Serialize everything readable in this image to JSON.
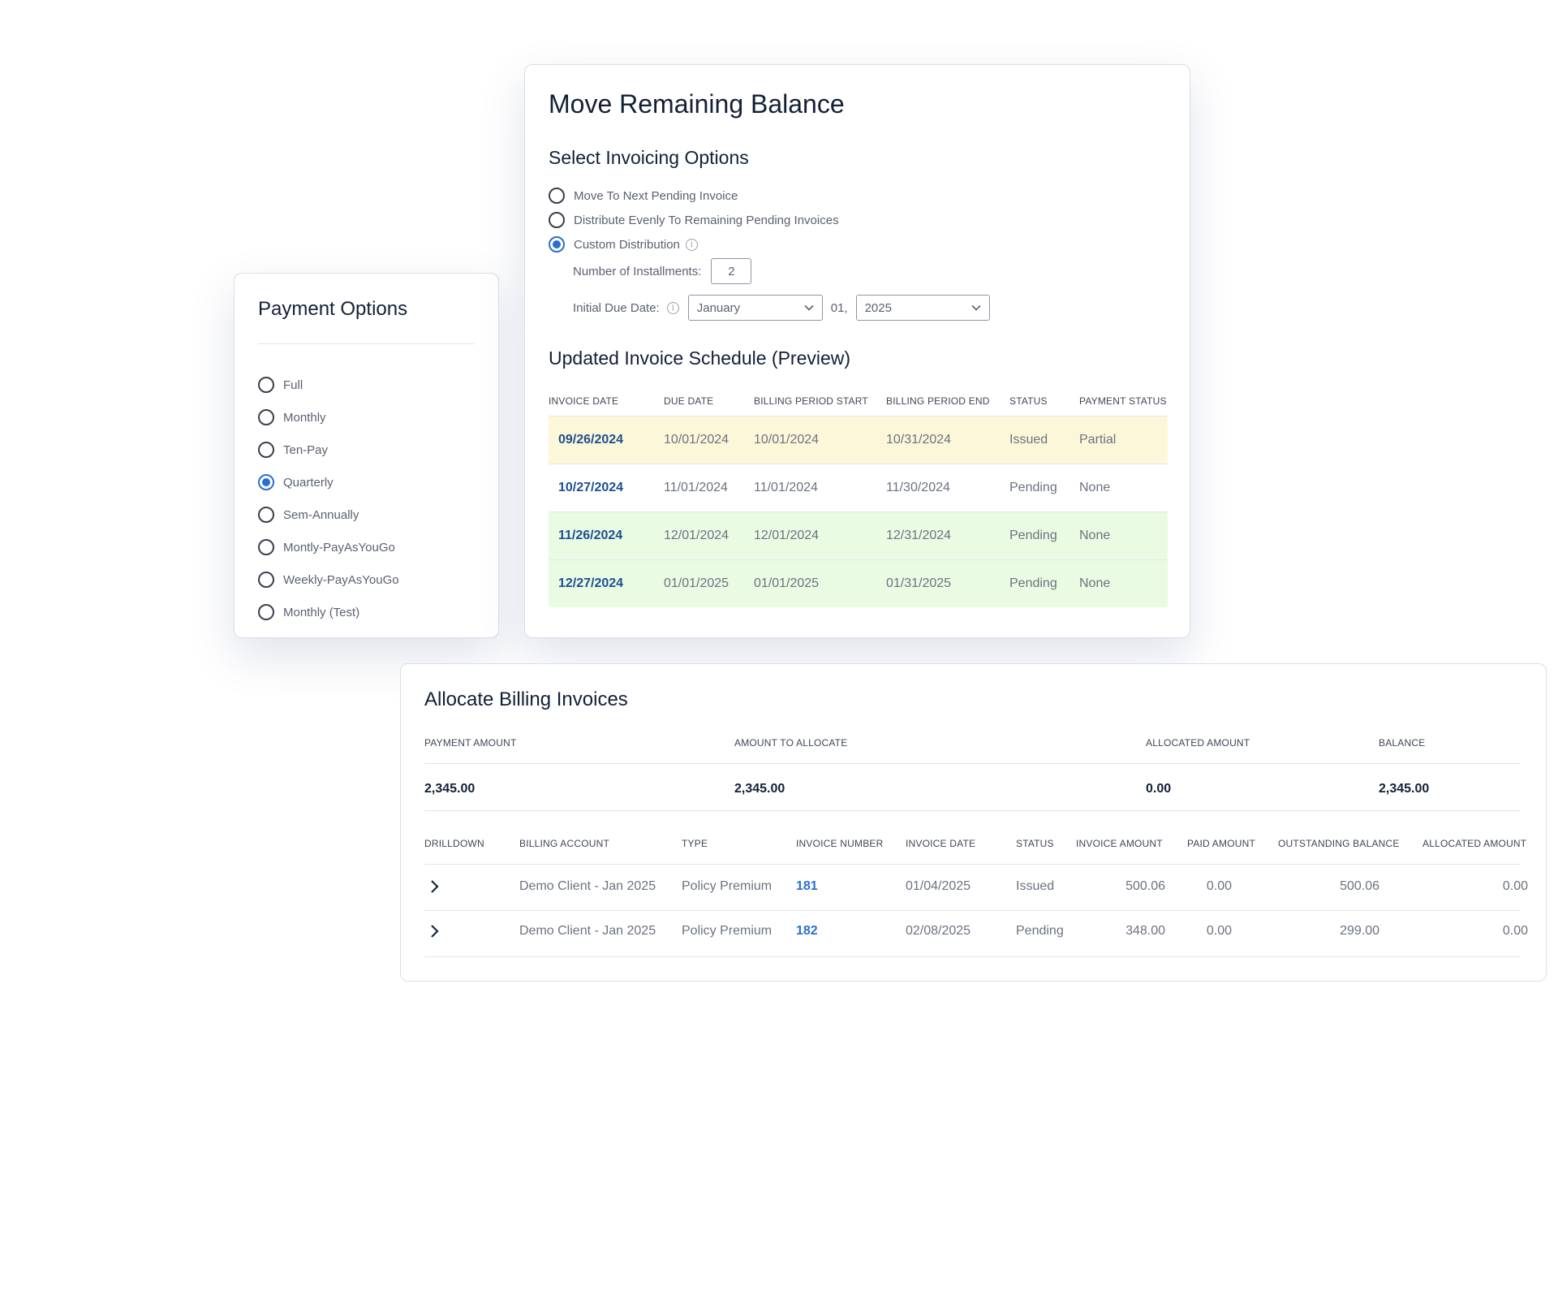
{
  "payment_options": {
    "title": "Payment Options",
    "options": [
      {
        "label": "Full",
        "selected": false
      },
      {
        "label": "Monthly",
        "selected": false
      },
      {
        "label": "Ten-Pay",
        "selected": false
      },
      {
        "label": "Quarterly",
        "selected": true
      },
      {
        "label": "Sem-Annually",
        "selected": false
      },
      {
        "label": "Montly-PayAsYouGo",
        "selected": false
      },
      {
        "label": "Weekly-PayAsYouGo",
        "selected": false
      },
      {
        "label": "Monthly (Test)",
        "selected": false
      }
    ]
  },
  "move_balance": {
    "title": "Move Remaining Balance",
    "subtitle": "Select Invoicing Options",
    "options": [
      {
        "label": "Move To Next Pending Invoice",
        "selected": false
      },
      {
        "label": "Distribute Evenly To Remaining Pending Invoices",
        "selected": false
      },
      {
        "label": "Custom Distribution",
        "selected": true
      }
    ],
    "installments_label": "Number of Installments:",
    "installments_value": "2",
    "due_date_label": "Initial Due Date:",
    "due_month": "January",
    "due_day": "01,",
    "due_year": "2025",
    "schedule_title": "Updated Invoice Schedule (Preview)",
    "schedule_headers": [
      "INVOICE DATE",
      "DUE DATE",
      "BILLING PERIOD START",
      "BILLING PERIOD END",
      "STATUS",
      "PAYMENT STATUS"
    ],
    "schedule_rows": [
      {
        "invoice_date": "09/26/2024",
        "due_date": "10/01/2024",
        "period_start": "10/01/2024",
        "period_end": "10/31/2024",
        "status": "Issued",
        "payment_status": "Partial",
        "highlight": "#fcf7d9"
      },
      {
        "invoice_date": "10/27/2024",
        "due_date": "11/01/2024",
        "period_start": "11/01/2024",
        "period_end": "11/30/2024",
        "status": "Pending",
        "payment_status": "None",
        "highlight": "#ffffff"
      },
      {
        "invoice_date": "11/26/2024",
        "due_date": "12/01/2024",
        "period_start": "12/01/2024",
        "period_end": "12/31/2024",
        "status": "Pending",
        "payment_status": "None",
        "highlight": "#eafbe4"
      },
      {
        "invoice_date": "12/27/2024",
        "due_date": "01/01/2025",
        "period_start": "01/01/2025",
        "period_end": "01/31/2025",
        "status": "Pending",
        "payment_status": "None",
        "highlight": "#eafbe4"
      }
    ]
  },
  "allocate": {
    "title": "Allocate Billing Invoices",
    "summary_headers": {
      "payment_amount": "PAYMENT AMOUNT",
      "amount_to_allocate": "AMOUNT TO ALLOCATE",
      "allocated_amount": "ALLOCATED AMOUNT",
      "balance": "BALANCE"
    },
    "summary_values": {
      "payment_amount": "2,345.00",
      "amount_to_allocate": "2,345.00",
      "allocated_amount": "0.00",
      "balance": "2,345.00"
    },
    "table_headers": {
      "drilldown": "DRILLDOWN",
      "billing_account": "BILLING ACCOUNT",
      "type": "TYPE",
      "invoice_number": "INVOICE NUMBER",
      "invoice_date": "INVOICE DATE",
      "status": "STATUS",
      "invoice_amount": "INVOICE AMOUNT",
      "paid_amount": "PAID AMOUNT",
      "outstanding_balance": "OUTSTANDING BALANCE",
      "allocated_amount": "ALLOCATED AMOUNT"
    },
    "rows": [
      {
        "billing_account": "Demo Client - Jan 2025",
        "type": "Policy Premium",
        "invoice_number": "181",
        "invoice_date": "01/04/2025",
        "status": "Issued",
        "invoice_amount": "500.06",
        "paid_amount": "0.00",
        "outstanding_balance": "500.06",
        "allocated_amount": "0.00"
      },
      {
        "billing_account": "Demo Client - Jan 2025",
        "type": "Policy Premium",
        "invoice_number": "182",
        "invoice_date": "02/08/2025",
        "status": "Pending",
        "invoice_amount": "348.00",
        "paid_amount": "0.00",
        "outstanding_balance": "299.00",
        "allocated_amount": "0.00"
      }
    ]
  },
  "colors": {
    "accent": "#2a6fd0",
    "link_dark": "#1d4f91",
    "heading": "#132036",
    "row_issued": "#fcf7d9",
    "row_pending_new": "#eafbe4"
  },
  "icons": {
    "radio": "radio-icon",
    "info": "info-icon",
    "dropdown": "chevron-down-icon",
    "expand": "chevron-right-icon"
  }
}
